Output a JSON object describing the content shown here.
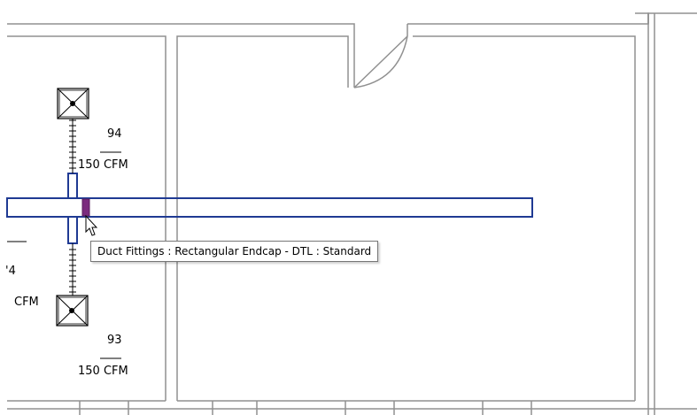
{
  "tags": {
    "upper_diffuser_number": "94",
    "upper_diffuser_flow": "150 CFM",
    "lower_diffuser_number": "93",
    "lower_diffuser_flow": "150 CFM",
    "cut_off_number": "'4",
    "cut_off_flow": "CFM"
  },
  "tooltip": {
    "text": "Duct Fittings : Rectangular Endcap - DTL : Standard"
  },
  "colors": {
    "duct": "#1f3a93",
    "endcap_highlight": "#7b2b7e",
    "wall": "#909090",
    "diffuser": "#000000"
  },
  "icons": [
    "supply-diffuser-icon",
    "rectangular-endcap",
    "mouse-pointer-icon"
  ]
}
